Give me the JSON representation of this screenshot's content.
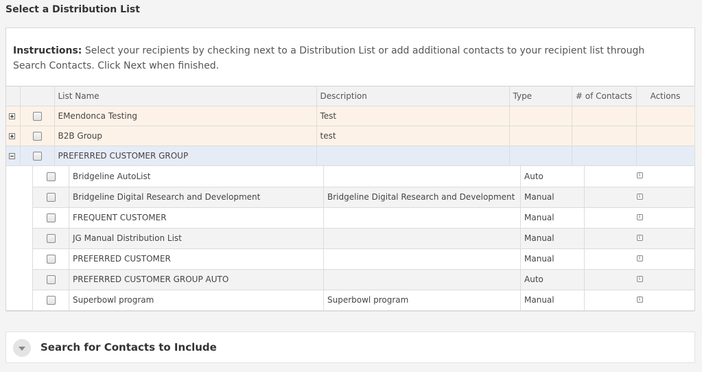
{
  "page": {
    "title": "Select a Distribution List"
  },
  "instructions": {
    "label": "Instructions:",
    "text": " Select your recipients by checking next to a Distribution List or add additional contacts to your recipient list through Search Contacts. Click Next when finished."
  },
  "table": {
    "headers": {
      "list_name": "List Name",
      "description": "Description",
      "type": "Type",
      "contacts": "# of Contacts",
      "actions": "Actions"
    },
    "parents": [
      {
        "name": "EMendonca Testing",
        "description": "Test",
        "type": "",
        "contacts": "",
        "expanded": false
      },
      {
        "name": "B2B Group",
        "description": "test",
        "type": "",
        "contacts": "",
        "expanded": false
      },
      {
        "name": "PREFERRED CUSTOMER GROUP",
        "description": "",
        "type": "",
        "contacts": "",
        "expanded": true
      }
    ],
    "children": [
      {
        "name": "Bridgeline AutoList",
        "description": "",
        "type": "Auto"
      },
      {
        "name": "Bridgeline Digital Research and Development",
        "description": "Bridgeline Digital Research and Development",
        "type": "Manual"
      },
      {
        "name": "FREQUENT CUSTOMER",
        "description": "",
        "type": "Manual"
      },
      {
        "name": "JG Manual Distribution List",
        "description": "",
        "type": "Manual"
      },
      {
        "name": "PREFERRED CUSTOMER",
        "description": "",
        "type": "Manual"
      },
      {
        "name": "PREFERRED CUSTOMER GROUP AUTO",
        "description": "",
        "type": "Auto"
      },
      {
        "name": "Superbowl program",
        "description": "Superbowl program",
        "type": "Manual"
      }
    ]
  },
  "search": {
    "title": "Search for Contacts to Include"
  },
  "icons": {
    "expand": "plus-box-icon",
    "collapse": "minus-box-icon",
    "info": "info-icon",
    "toggle": "chevron-down-icon"
  }
}
